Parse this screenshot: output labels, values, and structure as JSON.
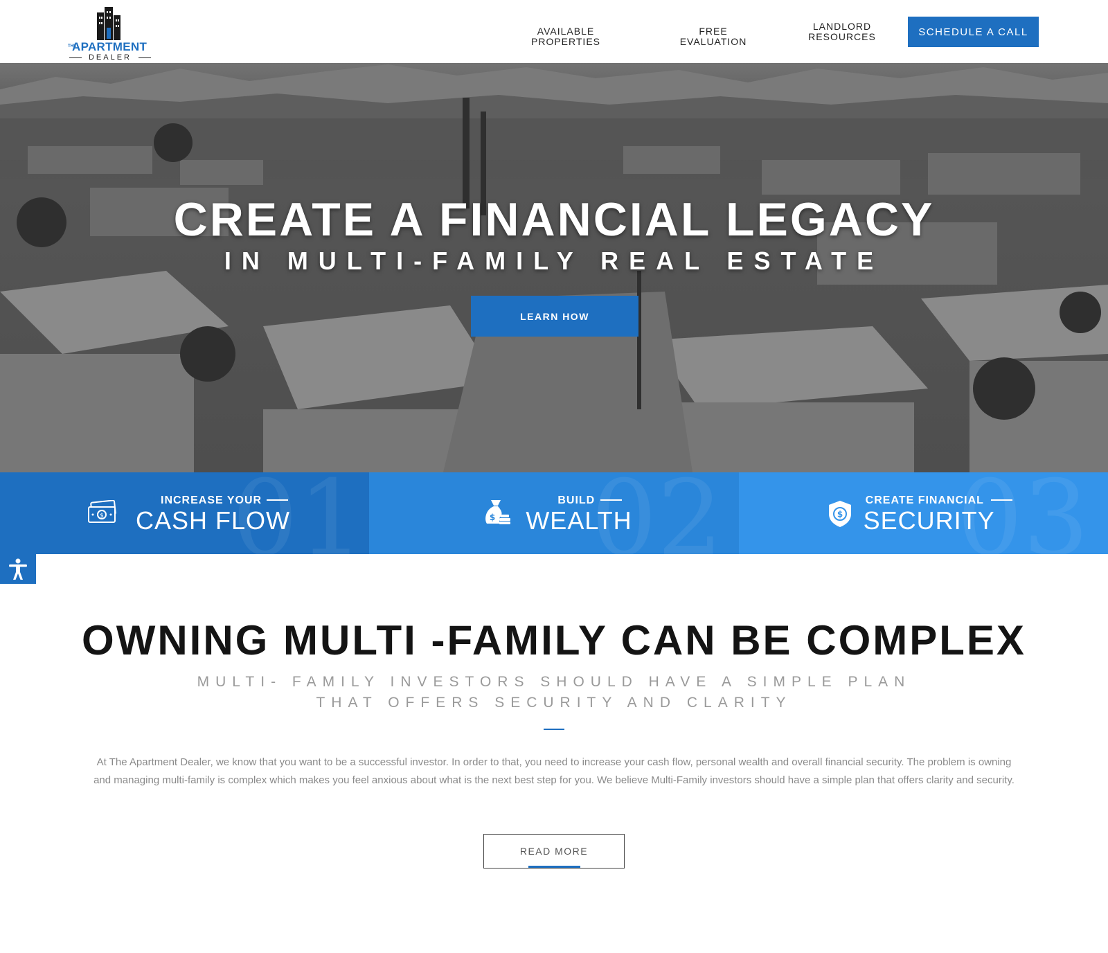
{
  "brand": {
    "logo_the": "THE",
    "logo_main": "APARTMENT",
    "logo_sub": "DEALER"
  },
  "nav": {
    "items": [
      {
        "label": "AVAILABLE PROPERTIES"
      },
      {
        "label": "FREE EVALUATION"
      },
      {
        "label": "LANDLORD RESOURCES"
      }
    ],
    "cta_label": "SCHEDULE A CALL"
  },
  "hero": {
    "title": "CREATE A FINANCIAL LEGACY",
    "subtitle": "IN MULTI-FAMILY REAL ESTATE",
    "button_label": "LEARN HOW"
  },
  "features": [
    {
      "number": "01",
      "small": "INCREASE YOUR",
      "big": "CASH FLOW",
      "icon": "cash-icon",
      "color": "#1e6fc0"
    },
    {
      "number": "02",
      "small": "BUILD",
      "big": "WEALTH",
      "icon": "money-bag-icon",
      "color": "#2a86da"
    },
    {
      "number": "03",
      "small": "CREATE FINANCIAL",
      "big": "SECURITY",
      "icon": "shield-dollar-icon",
      "color": "#3494ea"
    }
  ],
  "accessibility": {
    "icon": "accessibility-icon"
  },
  "content": {
    "title": "OWNING MULTI -FAMILY CAN BE COMPLEX",
    "subtitle_line1": "MULTI- FAMILY INVESTORS SHOULD HAVE A SIMPLE PLAN",
    "subtitle_line2": "THAT OFFERS SECURITY AND CLARITY",
    "body": "At The Apartment Dealer, we know that you want to be a successful investor. In order to that, you need to increase your cash flow, personal wealth and overall financial security. The problem is owning and managing multi-family is complex which makes you feel anxious about what is the next best step for you. We believe Multi-Family investors should have a simple plan that offers clarity and security.",
    "read_more_label": "READ MORE"
  },
  "colors": {
    "accent": "#1e6fc0",
    "accent_mid": "#2a86da",
    "accent_light": "#3494ea"
  }
}
